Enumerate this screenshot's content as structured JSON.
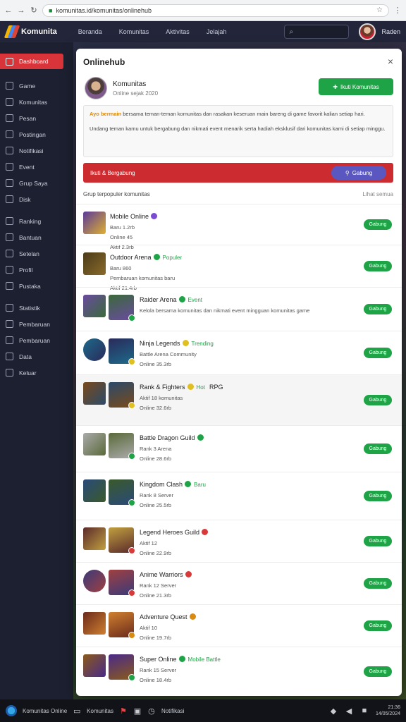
{
  "browser": {
    "url": "komunitas.id/komunitas/onlinehub",
    "back": "←",
    "forward": "→",
    "reload": "↻",
    "lock": "🔒",
    "bookmark": "☆",
    "menu": "⋮"
  },
  "app": {
    "name": "Komunita",
    "nav": [
      "Beranda",
      "Komunitas",
      "Aktivitas",
      "Jelajah"
    ],
    "search_icon": "search-icon",
    "user_name": "Raden"
  },
  "sidebar": {
    "items": [
      {
        "label": "Dashboard",
        "icon": "home-icon",
        "active": true
      },
      {
        "label": "Game",
        "icon": "gamepad-icon"
      },
      {
        "label": "Komunitas",
        "icon": "users-icon"
      },
      {
        "label": "Pesan",
        "icon": "chat-icon"
      },
      {
        "label": "Postingan",
        "icon": "post-icon"
      },
      {
        "label": "Notifikasi",
        "icon": "bell-icon"
      },
      {
        "label": "Event",
        "icon": "calendar-icon"
      },
      {
        "label": "Grup Saya",
        "icon": "group-icon"
      },
      {
        "label": "Disk",
        "icon": "disk-icon"
      },
      {
        "label": "Ranking",
        "icon": "trophy-icon"
      },
      {
        "label": "Bantuan",
        "icon": "help-icon"
      },
      {
        "label": "Setelan",
        "icon": "settings-icon"
      },
      {
        "label": "Profil",
        "icon": "profile-icon"
      },
      {
        "label": "Pustaka",
        "icon": "library-icon"
      },
      {
        "label": "Statistik",
        "icon": "stats-icon"
      },
      {
        "label": "Pembaruan",
        "icon": "update-icon"
      },
      {
        "label": "Pembaruan",
        "icon": "refresh-icon"
      },
      {
        "label": "Data",
        "icon": "data-icon"
      },
      {
        "label": "Keluar",
        "icon": "logout-icon"
      }
    ]
  },
  "modal": {
    "title": "Onlinehub",
    "close": "×",
    "profile_name": "Komunitas",
    "profile_sub": "Online sejak 2020",
    "primary_button": "Ikuti Komunitas",
    "info_highlight": "Ayo bermain",
    "info_p1": "bersama teman-teman komunitas dan rasakan keseruan main bareng di game favorit kalian setiap hari.",
    "info_p2": "Undang teman kamu untuk bergabung dan nikmati event menarik serta hadiah eksklusif dari komunitas kami di setiap minggu.",
    "alert_text": "Ikuti & Bergabung",
    "alert_button": "Gabung",
    "list_header_left": "Grup terpopuler komunitas",
    "list_header_right": "Lihat semua"
  },
  "rows": [
    {
      "title": "Mobile Online",
      "line1": "Baru 1.2rb",
      "line2": "Online 45",
      "line3": "Aktif 2.3rb",
      "button": "Gabung"
    },
    {
      "title": "Outdoor Arena",
      "line1": "Baru 860",
      "line2": "Pembaruan komunitas baru",
      "badge": "Populer",
      "line3": "Aktif 21.4rb",
      "button": "Gabung"
    },
    {
      "title": "Raider Arena",
      "line1": "Kelola bersama komunitas dan nikmati event mingguan komunitas game",
      "badge": "Event",
      "button": "Gabung"
    },
    {
      "title": "Ninja Legends",
      "line1": "Battle Arena Community",
      "badge": "Trending",
      "line3": "Online 35.3rb",
      "button": "Gabung"
    },
    {
      "title": "Rank & Fighters",
      "badge": "Hot",
      "extra": "RPG",
      "line2": "Aktif 18 komunitas",
      "line3": "Online 32.6rb",
      "button": "Gabung"
    },
    {
      "title": "Battle Dragon Guild",
      "line2": "Rank 3 Arena",
      "line3": "Online 28.6rb",
      "button": "Gabung"
    },
    {
      "title": "Kingdom Clash",
      "badge": "Baru",
      "line2": "Rank 8 Server",
      "line3": "Online 25.5rb",
      "button": "Gabung"
    },
    {
      "title": "Legend Heroes Guild",
      "line2": "Aktif 12",
      "line3": "Online 22.9rb",
      "button": "Gabung"
    },
    {
      "title": "Anime Warriors",
      "line2": "Rank 12 Server",
      "line3": "Online 21.3rb",
      "button": "Gabung"
    },
    {
      "title": "Adventure Quest",
      "line2": "Aktif 10",
      "line3": "Online 19.7rb",
      "button": "Gabung"
    },
    {
      "title": "Super Online",
      "badge": "Mobile Battle",
      "line2": "Rank 15 Server",
      "line3": "Online 18.4rb",
      "button": "Gabung"
    }
  ],
  "taskbar": {
    "app_label": "Komunitas Online",
    "window_label": "Komunitas",
    "tray_label": "Notifikasi",
    "time": "21:36",
    "date": "14/05/2024"
  },
  "colors": {
    "accent_red": "#d9343a",
    "accent_green": "#1ea446",
    "accent_purple": "#5a58c0"
  }
}
